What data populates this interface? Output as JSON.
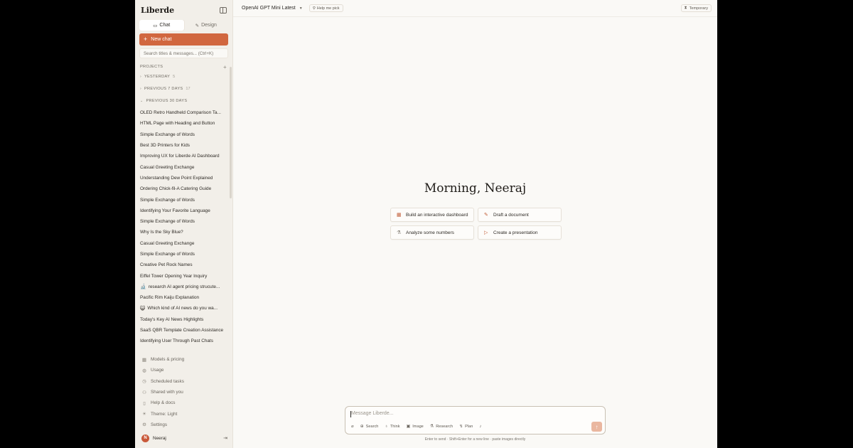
{
  "sidebar": {
    "logo": "Liberde",
    "tabs": [
      {
        "label": "Chat",
        "icon": "chat-bubble-icon",
        "active": true
      },
      {
        "label": "Design",
        "icon": "pen-icon",
        "active": false
      }
    ],
    "new_chat_label": "New chat",
    "search_placeholder": "Search titles & messages... (Ctrl+K)",
    "projects_label": "PROJECTS",
    "groups": [
      {
        "label": "YESTERDAY",
        "count": "5"
      },
      {
        "label": "PREVIOUS 7 DAYS",
        "count": "17"
      },
      {
        "label": "PREVIOUS 30 DAYS",
        "count": ""
      }
    ],
    "chats": [
      {
        "title": "OLED Retro Handheld Comparison Ta...",
        "emoji": ""
      },
      {
        "title": "HTML Page with Heading and Button",
        "emoji": ""
      },
      {
        "title": "Simple Exchange of Words",
        "emoji": ""
      },
      {
        "title": "Best 3D Printers for Kids",
        "emoji": ""
      },
      {
        "title": "Improving UX for Liberde AI Dashboard",
        "emoji": ""
      },
      {
        "title": "Casual Greeting Exchange",
        "emoji": ""
      },
      {
        "title": "Understanding Dew Point Explained",
        "emoji": ""
      },
      {
        "title": "Ordering Chick-fil-A Catering Guide",
        "emoji": ""
      },
      {
        "title": "Simple Exchange of Words",
        "emoji": ""
      },
      {
        "title": "Identifying Your Favorite Language",
        "emoji": ""
      },
      {
        "title": "Simple Exchange of Words",
        "emoji": ""
      },
      {
        "title": "Why Is the Sky Blue?",
        "emoji": ""
      },
      {
        "title": "Casual Greeting Exchange",
        "emoji": ""
      },
      {
        "title": "Simple Exchange of Words",
        "emoji": ""
      },
      {
        "title": "Creative Pet Rock Names",
        "emoji": ""
      },
      {
        "title": "Eiffel Tower Opening Year Inquiry",
        "emoji": ""
      },
      {
        "title": "research AI agent pricing strucute...",
        "emoji": "🔬"
      },
      {
        "title": "Pacific Rim Kaiju Explanation",
        "emoji": ""
      },
      {
        "title": "Which kind of AI news do you wa...",
        "emoji": "😺"
      },
      {
        "title": "Today's Key AI News Highlights",
        "emoji": ""
      },
      {
        "title": "SaaS QBR Template Creation Assistance",
        "emoji": ""
      },
      {
        "title": "Identifying User Through Past Chats",
        "emoji": ""
      }
    ],
    "footer": [
      {
        "label": "Models & pricing",
        "icon": "grid-icon"
      },
      {
        "label": "Usage",
        "icon": "gauge-icon"
      },
      {
        "label": "Scheduled tasks",
        "icon": "clock-icon"
      },
      {
        "label": "Shared with you",
        "icon": "users-icon"
      },
      {
        "label": "Help & docs",
        "icon": "doc-icon"
      },
      {
        "label": "Theme: Light",
        "icon": "sun-icon"
      },
      {
        "label": "Settings",
        "icon": "gear-icon"
      }
    ],
    "user": {
      "initial": "N",
      "name": "Neeraj"
    }
  },
  "topbar": {
    "model": "OpenAI GPT Mini Latest",
    "help_me_pick": "Help me pick",
    "temporary": "Temporary"
  },
  "main": {
    "greeting": "Morning, Neeraj",
    "suggestions": [
      {
        "label": "Build an interactive dashboard",
        "icon": "grid-icon"
      },
      {
        "label": "Draft a document",
        "icon": "pencil-icon"
      },
      {
        "label": "Analyze some numbers",
        "icon": "flask-icon"
      },
      {
        "label": "Create a presentation",
        "icon": "play-icon"
      }
    ]
  },
  "composer": {
    "placeholder": "Message Liberde...",
    "tools": [
      {
        "label": "",
        "icon": "paperclip-icon"
      },
      {
        "label": "Search",
        "icon": "globe-icon"
      },
      {
        "label": "Think",
        "icon": "bulb-icon"
      },
      {
        "label": "Image",
        "icon": "image-icon"
      },
      {
        "label": "Research",
        "icon": "flask-icon"
      },
      {
        "label": "Plan",
        "icon": "plan-icon"
      },
      {
        "label": "",
        "icon": "mic-icon"
      }
    ],
    "hint": "Enter to send · Shift+Enter for a new line · paste images directly"
  },
  "colors": {
    "accent": "#d1673f",
    "sidebar_bg": "#f2efe9",
    "main_bg": "#faf9f6"
  }
}
